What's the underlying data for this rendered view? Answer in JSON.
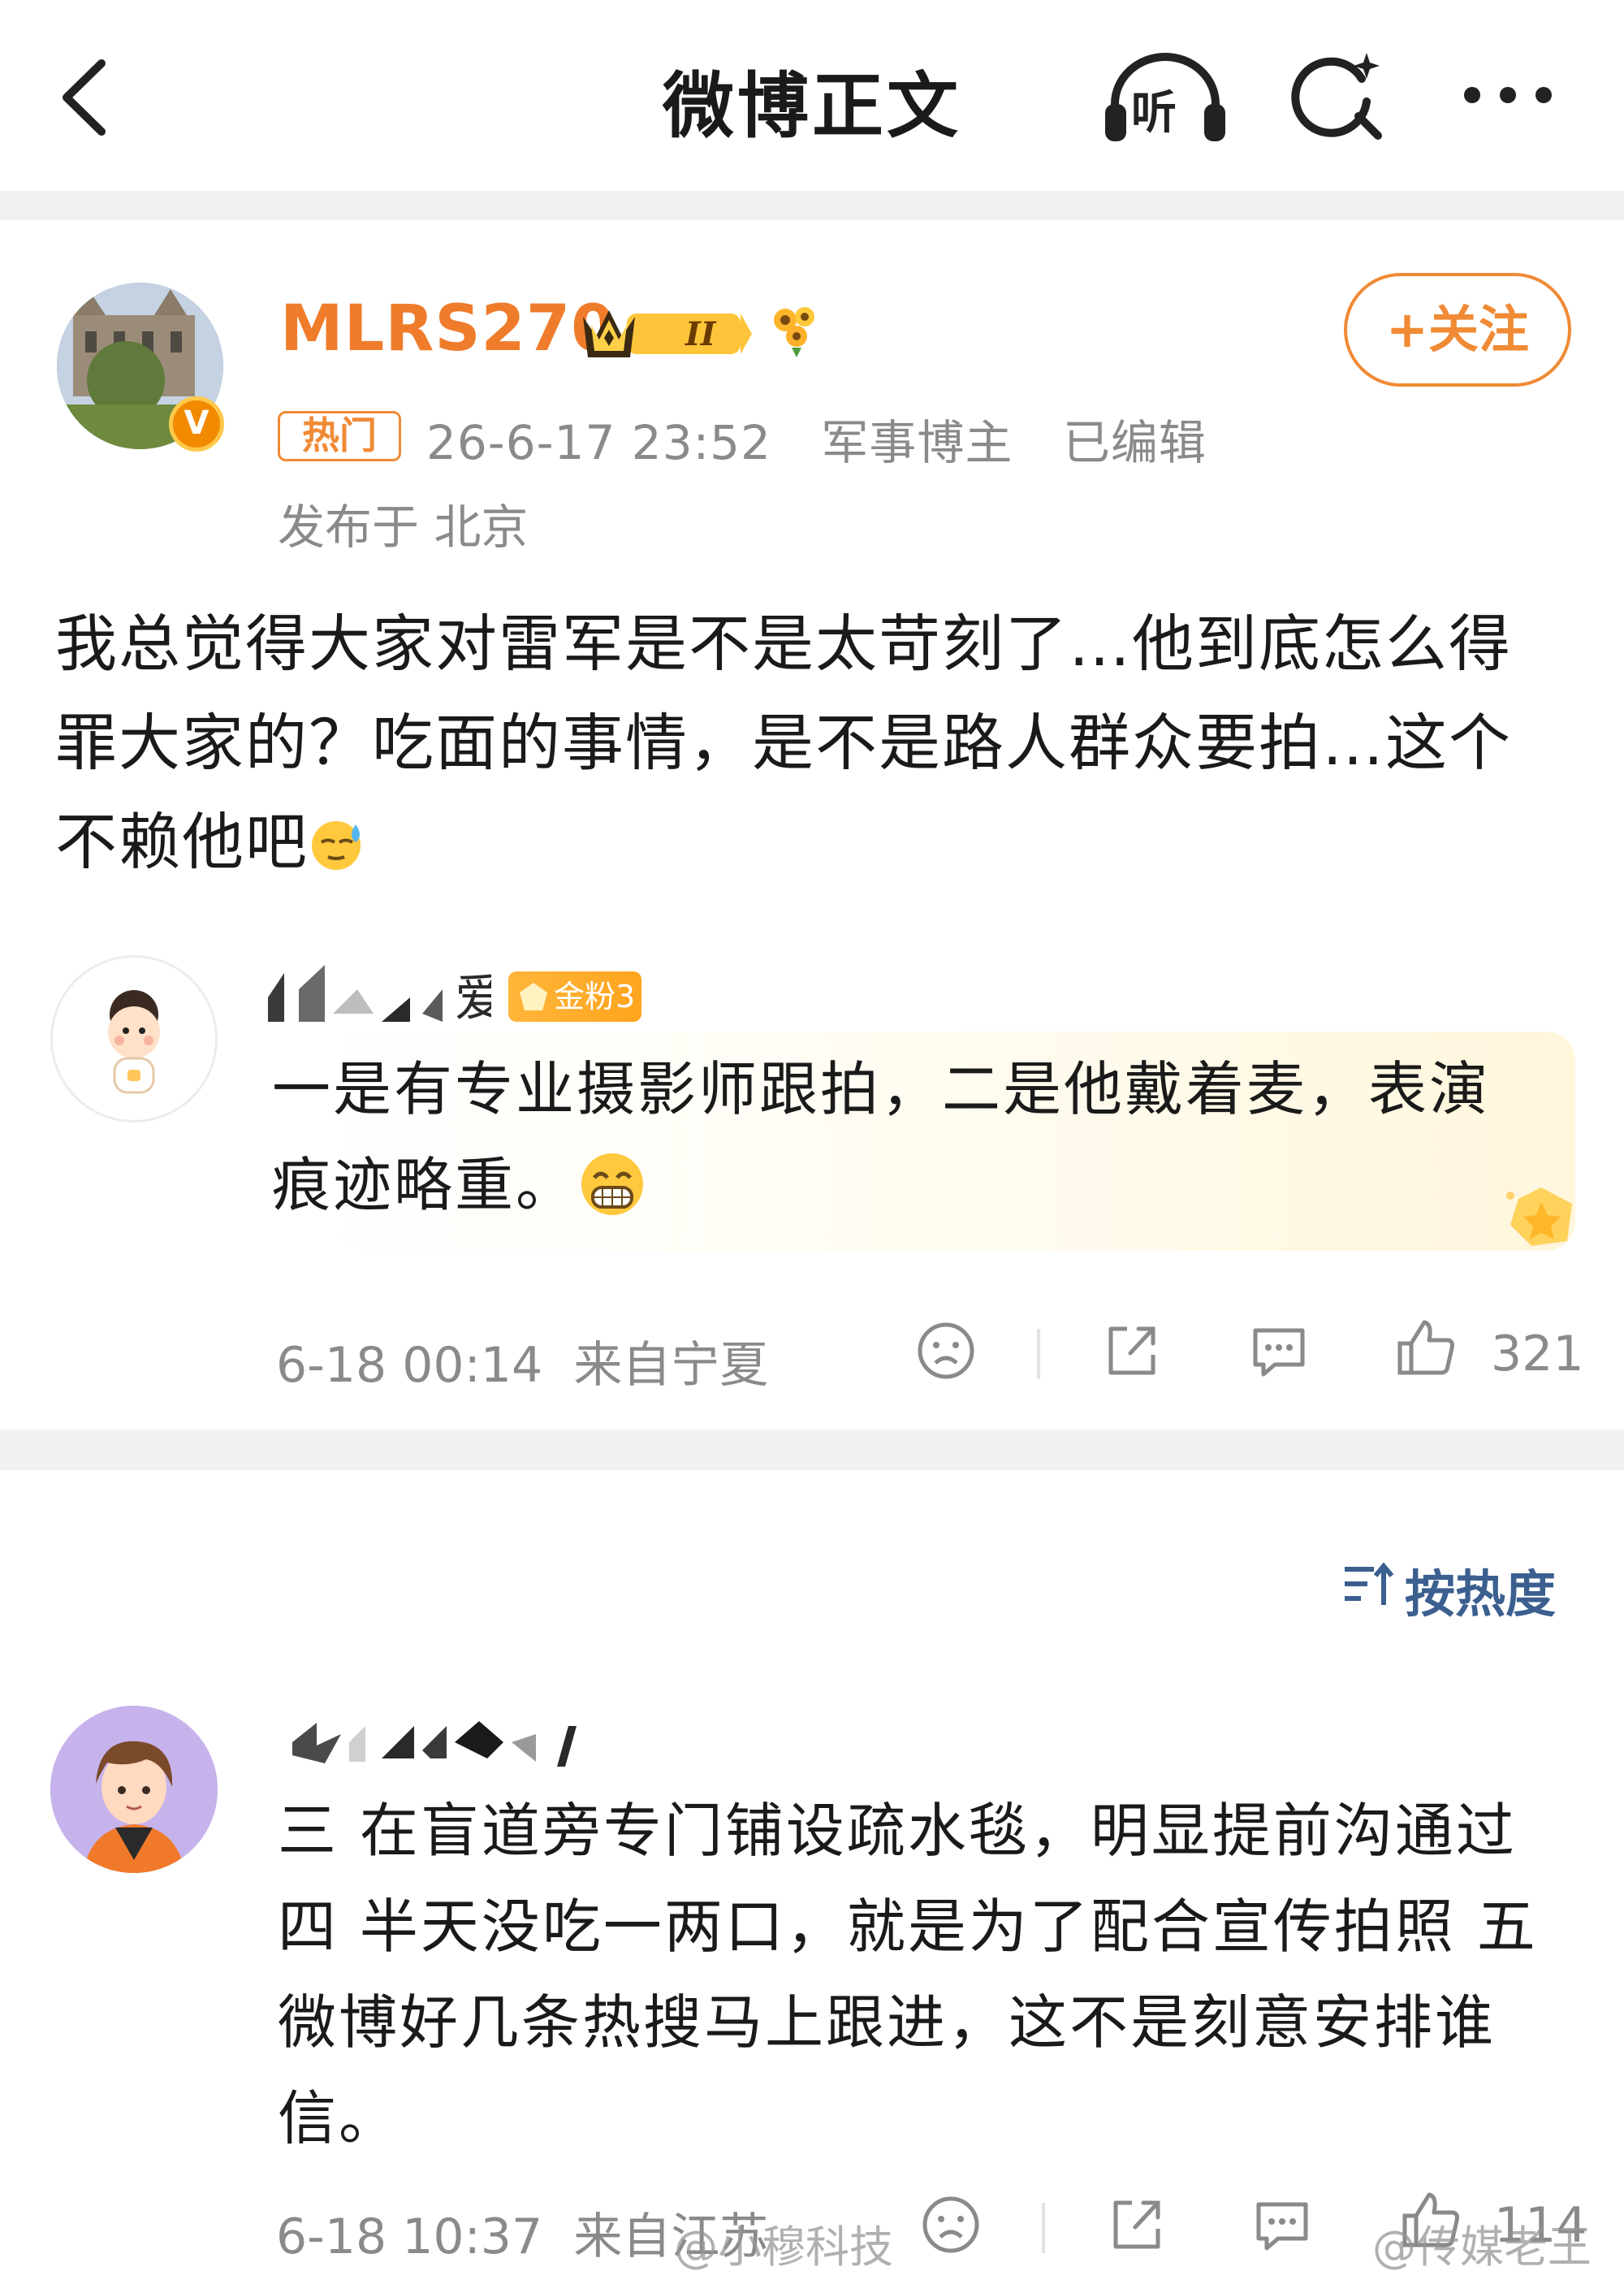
{
  "header": {
    "title": "微博正文",
    "listen_label": "听"
  },
  "post": {
    "username": "MLRS270",
    "verified_badge": "V",
    "follow_label": "+关注",
    "hot_tag": "热门",
    "datetime": "26-6-17 23:52",
    "author_role": "军事博主",
    "edited": "已编辑",
    "location": "发布于 北京",
    "text": "我总觉得大家对雷军是不是太苛刻了…他到底怎么得罪大家的？吃面的事情，是不是路人群众要拍…这个不赖他吧"
  },
  "quoted_comment": {
    "name_suffix": "爱",
    "fan_badge": "金粉3",
    "text": "一是有专业摄影师跟拍，二是他戴着麦，表演痕迹略重。"
  },
  "post_actions": {
    "time": "6-18 00:14",
    "source": "来自宁夏",
    "likes": "321"
  },
  "sort": {
    "label": "按热度"
  },
  "comment2": {
    "text": "三 在盲道旁专门铺设疏水毯，明显提前沟通过 四 半天没吃一两口，就是为了配合宣传拍照 五 微博好几条热搜马上跟进，这不是刻意安排谁信。",
    "time": "6-18 10:37",
    "source": "来自江苏",
    "likes": "114"
  },
  "watermarks": [
    "@小穆科技",
    "@传媒老王"
  ],
  "colors": {
    "accent_orange": "#ef7c2b",
    "muted_gray": "#8a8a8a",
    "sort_blue": "#3b5f8f",
    "gold_badge": "#ffa41e"
  }
}
